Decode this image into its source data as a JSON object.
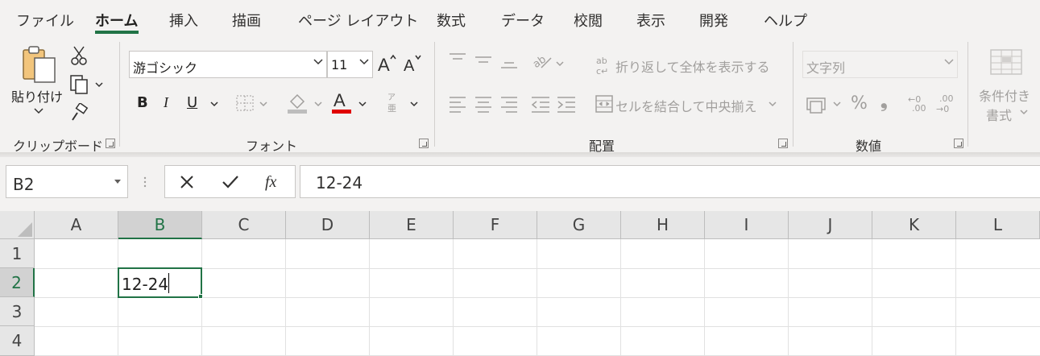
{
  "ribbon_tabs": [
    "ファイル",
    "ホーム",
    "挿入",
    "描画",
    "ページ レイアウト",
    "数式",
    "データ",
    "校閲",
    "表示",
    "開発",
    "ヘルプ"
  ],
  "active_tab": "ホーム",
  "clipboard": {
    "paste_label": "貼り付け",
    "group_label": "クリップボード"
  },
  "font": {
    "font_name": "游ゴシック",
    "font_size": "11",
    "furigana_top": "ア",
    "furigana_bottom": "亜",
    "group_label": "フォント",
    "font_color": "#e00000"
  },
  "alignment": {
    "wrap_text_label": "折り返して全体を表示する",
    "merge_center_label": "セルを結合して中央揃え",
    "group_label": "配置"
  },
  "number": {
    "format_value": "文字列",
    "percent_symbol": "%",
    "comma_symbol": "❟",
    "increase_decimal": ".00",
    "decrease_decimal": ".00",
    "group_label": "数値"
  },
  "styles": {
    "conditional_formatting_line1": "条件付き",
    "conditional_formatting_line2": "書式"
  },
  "formula_bar": {
    "name_box": "B2",
    "fx_symbol": "fx",
    "formula_value": "12-24"
  },
  "sheet": {
    "columns": [
      "A",
      "B",
      "C",
      "D",
      "E",
      "F",
      "G",
      "H",
      "I",
      "J",
      "K",
      "L"
    ],
    "rows": [
      "1",
      "2",
      "3",
      "4"
    ],
    "selected_column": "B",
    "selected_row": "2",
    "active_cell_value": "12-24"
  },
  "accent_color": "#217346"
}
